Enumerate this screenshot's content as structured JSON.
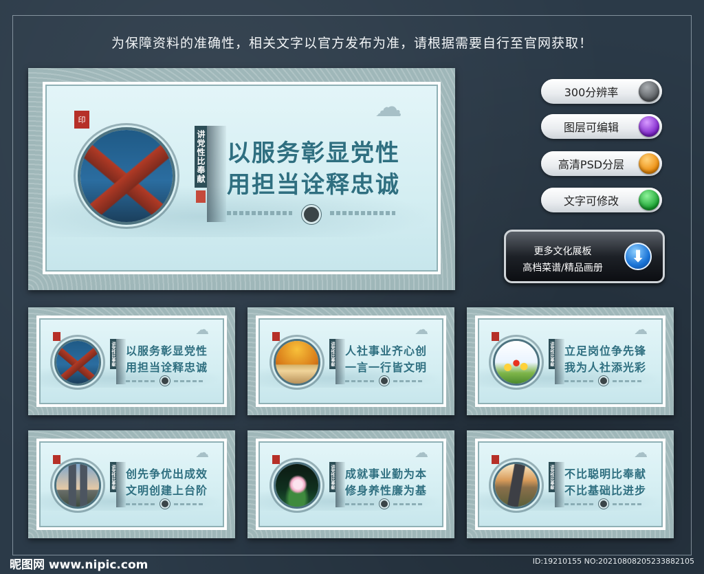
{
  "notice": "为保障资料的准确性，相关文字以官方发布为准，请根据需要自行至官网获取！",
  "main_board": {
    "seal": "印",
    "vertical": "讲党性比奉献",
    "line1": "以服务彰显党性",
    "line2": "用担当诠释忠诚"
  },
  "features": [
    {
      "label": "300分辨率",
      "color": "#6b6f73"
    },
    {
      "label": "图层可编辑",
      "color": "#8c2bd6"
    },
    {
      "label": "高清PSD分层",
      "color": "#f29a12"
    },
    {
      "label": "文字可修改",
      "color": "#22b23a"
    }
  ],
  "download": {
    "line1": "更多文化展板",
    "line2": "高档菜谱/精品画册",
    "arrow": "⬇"
  },
  "thumbs": [
    {
      "line1": "以服务彰显党性",
      "line2": "用担当诠释忠诚",
      "scene": "roof",
      "vertical": "讲党性比奉献"
    },
    {
      "line1": "人社事业齐心创",
      "line2": "一言一行皆文明",
      "scene": "arch",
      "vertical": "讲党性比奉献"
    },
    {
      "line1": "立足岗位争先锋",
      "line2": "我为人社添光彩",
      "scene": "tulip",
      "vertical": "讲党性比奉献"
    },
    {
      "line1": "创先争优出成效",
      "line2": "文明创建上台阶",
      "scene": "city",
      "vertical": "讲党性比奉献"
    },
    {
      "line1": "成就事业勤为本",
      "line2": "修身养性廉为基",
      "scene": "lotus",
      "vertical": "讲党性比奉献"
    },
    {
      "line1": "不比聪明比奉献",
      "line2": "不比基础比进步",
      "scene": "road",
      "vertical": "讲党性比奉献"
    }
  ],
  "footer": {
    "logo": "昵图网 www.nipic.com",
    "id": "ID:19210155 NO:20210808205233882105"
  }
}
